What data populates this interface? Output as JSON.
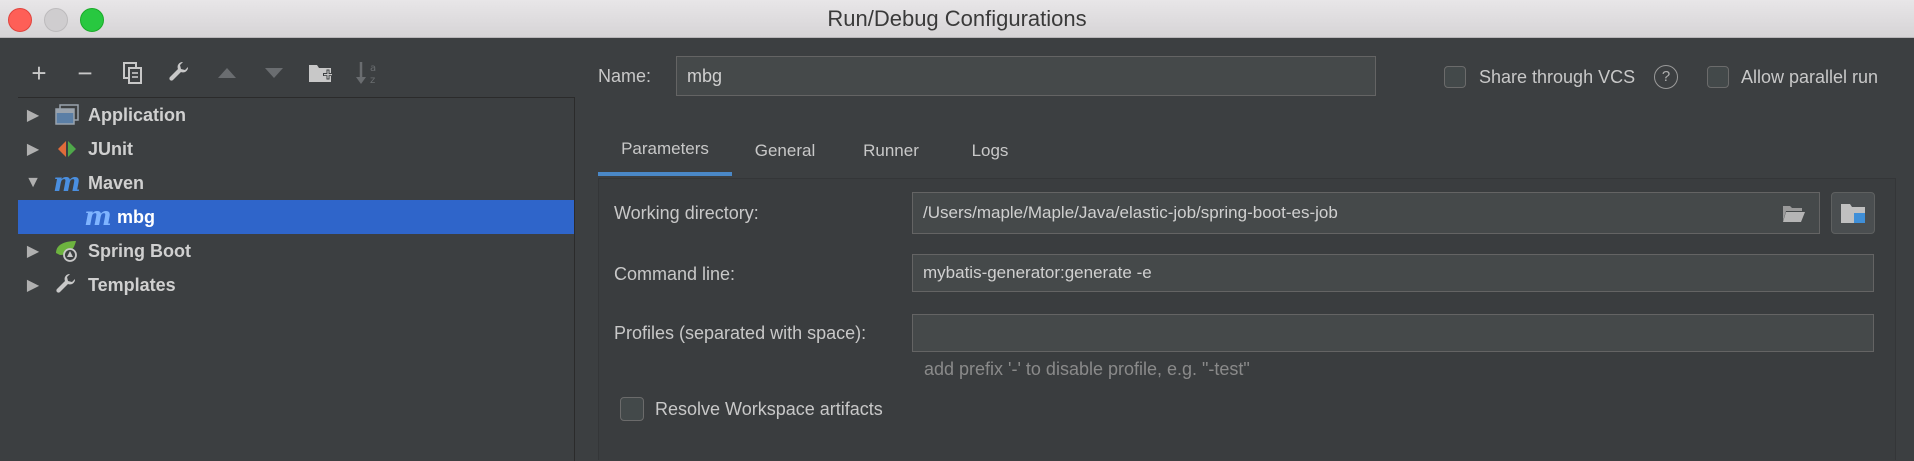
{
  "window": {
    "title": "Run/Debug Configurations"
  },
  "toolbar": {
    "add": "+",
    "remove": "−"
  },
  "tree": {
    "items": [
      {
        "label": "Application",
        "expanded": false,
        "icon": "application-icon"
      },
      {
        "label": "JUnit",
        "expanded": false,
        "icon": "junit-icon"
      },
      {
        "label": "Maven",
        "expanded": true,
        "icon": "maven-icon"
      },
      {
        "label": "mbg",
        "child": true,
        "selected": true,
        "icon": "maven-icon"
      },
      {
        "label": "Spring Boot",
        "expanded": false,
        "icon": "spring-boot-icon"
      },
      {
        "label": "Templates",
        "expanded": false,
        "icon": "wrench-icon"
      }
    ],
    "arrows": {
      "collapsed": "▶",
      "expanded": "▼"
    }
  },
  "name_field": {
    "label": "Name:",
    "value": "mbg"
  },
  "share_vcs": {
    "label": "Share through VCS",
    "checked": false
  },
  "help": "?",
  "allow_parallel": {
    "label": "Allow parallel run",
    "checked": false
  },
  "tabs": [
    {
      "label": "Parameters",
      "active": true
    },
    {
      "label": "General",
      "active": false
    },
    {
      "label": "Runner",
      "active": false
    },
    {
      "label": "Logs",
      "active": false
    }
  ],
  "parameters": {
    "working_dir": {
      "label": "Working directory:",
      "value": "/Users/maple/Maple/Java/elastic-job/spring-boot-es-job"
    },
    "command_line": {
      "label": "Command line:",
      "value": "mybatis-generator:generate -e"
    },
    "profiles": {
      "label": "Profiles (separated with space):",
      "value": "",
      "hint": "add prefix '-' to disable profile, e.g. \"-test\""
    },
    "resolve_workspace": {
      "label": "Resolve Workspace artifacts",
      "checked": false
    }
  },
  "colors": {
    "background": "#3c3f41",
    "selection": "#2f65ca",
    "accent": "#4a88c7"
  }
}
